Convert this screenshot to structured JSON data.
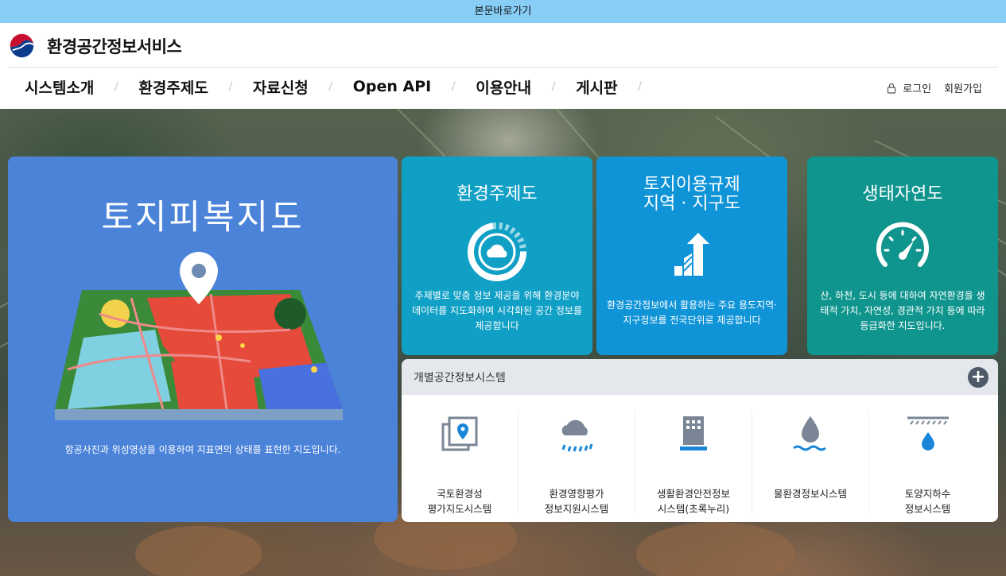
{
  "skip_link": "본문바로가기",
  "site": {
    "name": "환경공간정보서비스"
  },
  "nav": {
    "items": [
      "시스템소개",
      "환경주제도",
      "자료신청",
      "Open API",
      "이용안내",
      "게시판"
    ],
    "separator": "/"
  },
  "util": {
    "login": "로그인",
    "join": "회원가입"
  },
  "feature": {
    "title": "토지피복지도",
    "desc": "항공사진과 위성영상을 이용하여 지표면의 상태를 표현한 지도입니다."
  },
  "cards": [
    {
      "title": "환경주제도",
      "desc": "주제별로 맞춤 정보 제공을 위해 환경분야 데이터를 지도화하여 시각화된 공간 정보를 제공합니다",
      "icon": "donut-cloud-icon",
      "color": "#10a0c6"
    },
    {
      "title_line1": "토지이용규제",
      "title_line2": "지역 · 지구도",
      "desc": "환경공간정보에서 활용하는 주요 용도지역·지구정보를 전국단위로 제공합니다",
      "icon": "bar-arrow-up-icon",
      "color": "#0f94d8"
    },
    {
      "title": "생태자연도",
      "desc": "산, 하천, 도시 등에 대하여 자연환경을 생태적 가치, 자연성, 경관적 가치 등에 따라 등급화한 지도입니다.",
      "icon": "gauge-icon",
      "color": "#10958e"
    }
  ],
  "systems_panel": {
    "title": "개별공간정보시스템",
    "more": "+",
    "items": [
      {
        "line1": "국토환경성",
        "line2": "평가지도시스템",
        "icon": "map-pin-layers-icon"
      },
      {
        "line1": "환경영향평가",
        "line2": "정보지원시스템",
        "icon": "cloud-rain-icon"
      },
      {
        "line1": "생활환경안전정보",
        "line2": "시스템(초록누리)",
        "icon": "building-icon"
      },
      {
        "line1": "물환경정보시스템",
        "line2": "",
        "icon": "water-drop-icon"
      },
      {
        "line1": "토양지하수",
        "line2": "정보시스템",
        "icon": "groundwater-icon"
      }
    ]
  }
}
